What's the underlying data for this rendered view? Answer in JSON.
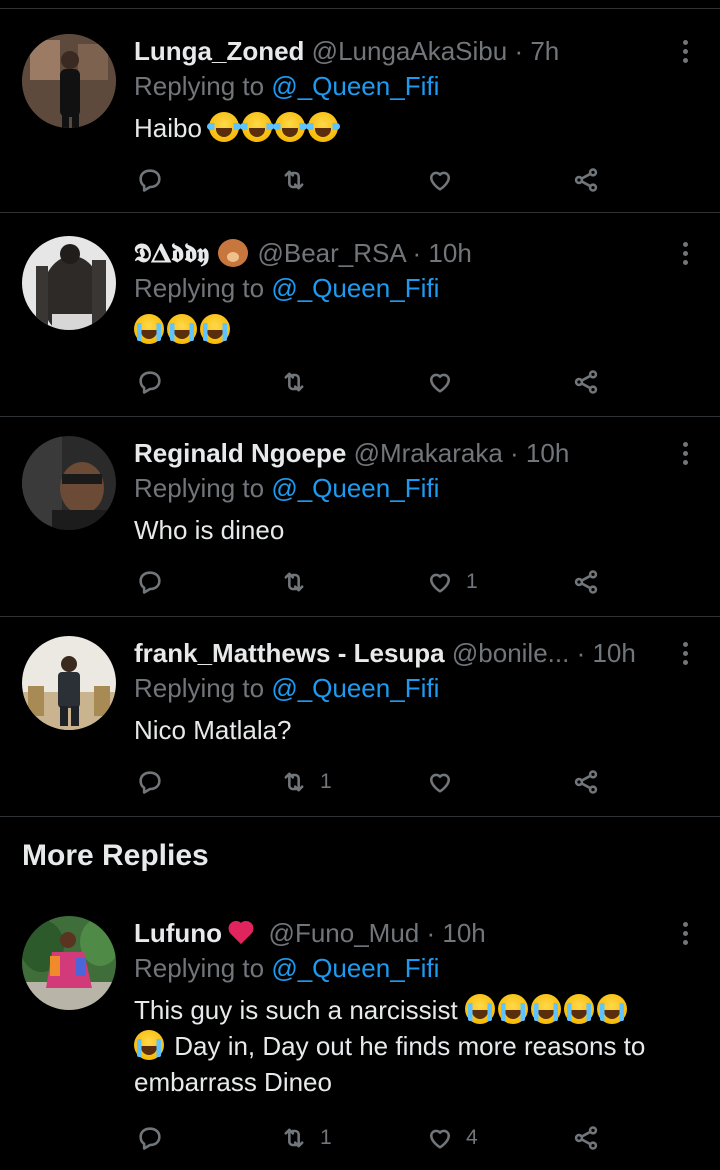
{
  "replies": [
    {
      "name": "Lunga_Zoned",
      "handle": "@LungaAkaSibu",
      "time": "· 7h",
      "replying_prefix": "Replying to ",
      "replying_to": "@_Queen_Fifi",
      "text": "Haibo",
      "emoji": [
        "laugh",
        "laugh",
        "laugh",
        "laugh"
      ],
      "avatar_colors": [
        "#6a5446",
        "#2b2320"
      ],
      "replies_count": "",
      "retweets_count": "",
      "likes_count": ""
    },
    {
      "name": "𝕯𝚫𝖉𝖉𝖞",
      "name_emoji": "bear",
      "handle": "@Bear_RSA",
      "time": "· 10h",
      "replying_prefix": "Replying to ",
      "replying_to": "@_Queen_Fifi",
      "text": "",
      "emoji": [
        "cry",
        "cry",
        "cry"
      ],
      "avatar_colors": [
        "#d9d9d9",
        "#3b3b3b"
      ],
      "replies_count": "",
      "retweets_count": "",
      "likes_count": ""
    },
    {
      "name": "Reginald Ngoepe",
      "handle": "@Mrakaraka",
      "time": "· 10h",
      "replying_prefix": "Replying to ",
      "replying_to": "@_Queen_Fifi",
      "text": "Who is dineo",
      "emoji": [],
      "avatar_colors": [
        "#4a4a4a",
        "#1f1f1f"
      ],
      "replies_count": "",
      "retweets_count": "",
      "likes_count": "1"
    },
    {
      "name": "frank_Matthews - Lesupa",
      "handle": "@bonile...",
      "time": "· 10h",
      "replying_prefix": "Replying to ",
      "replying_to": "@_Queen_Fifi",
      "text": "Nico Matlala?",
      "emoji": [],
      "avatar_colors": [
        "#e8e4df",
        "#8f7a60"
      ],
      "replies_count": "",
      "retweets_count": "1",
      "likes_count": ""
    }
  ],
  "more_replies_title": "More Replies",
  "more": {
    "name": "Lufuno",
    "name_emoji": "heart",
    "handle": "@Funo_Mud",
    "time": "· 10h",
    "replying_prefix": "Replying to ",
    "replying_to": "@_Queen_Fifi",
    "text_1": "This guy is such a narcissist",
    "text_2": "Day in, Day out he finds more reasons to",
    "text_3": "embarrass Dineo",
    "emoji": [
      "cry",
      "cry",
      "cry",
      "cry",
      "cry"
    ],
    "emoji_2": [
      "cry"
    ],
    "avatar_colors": [
      "#3d6b3a",
      "#c23b6a"
    ],
    "replies_count": "",
    "retweets_count": "1",
    "likes_count": "4"
  }
}
